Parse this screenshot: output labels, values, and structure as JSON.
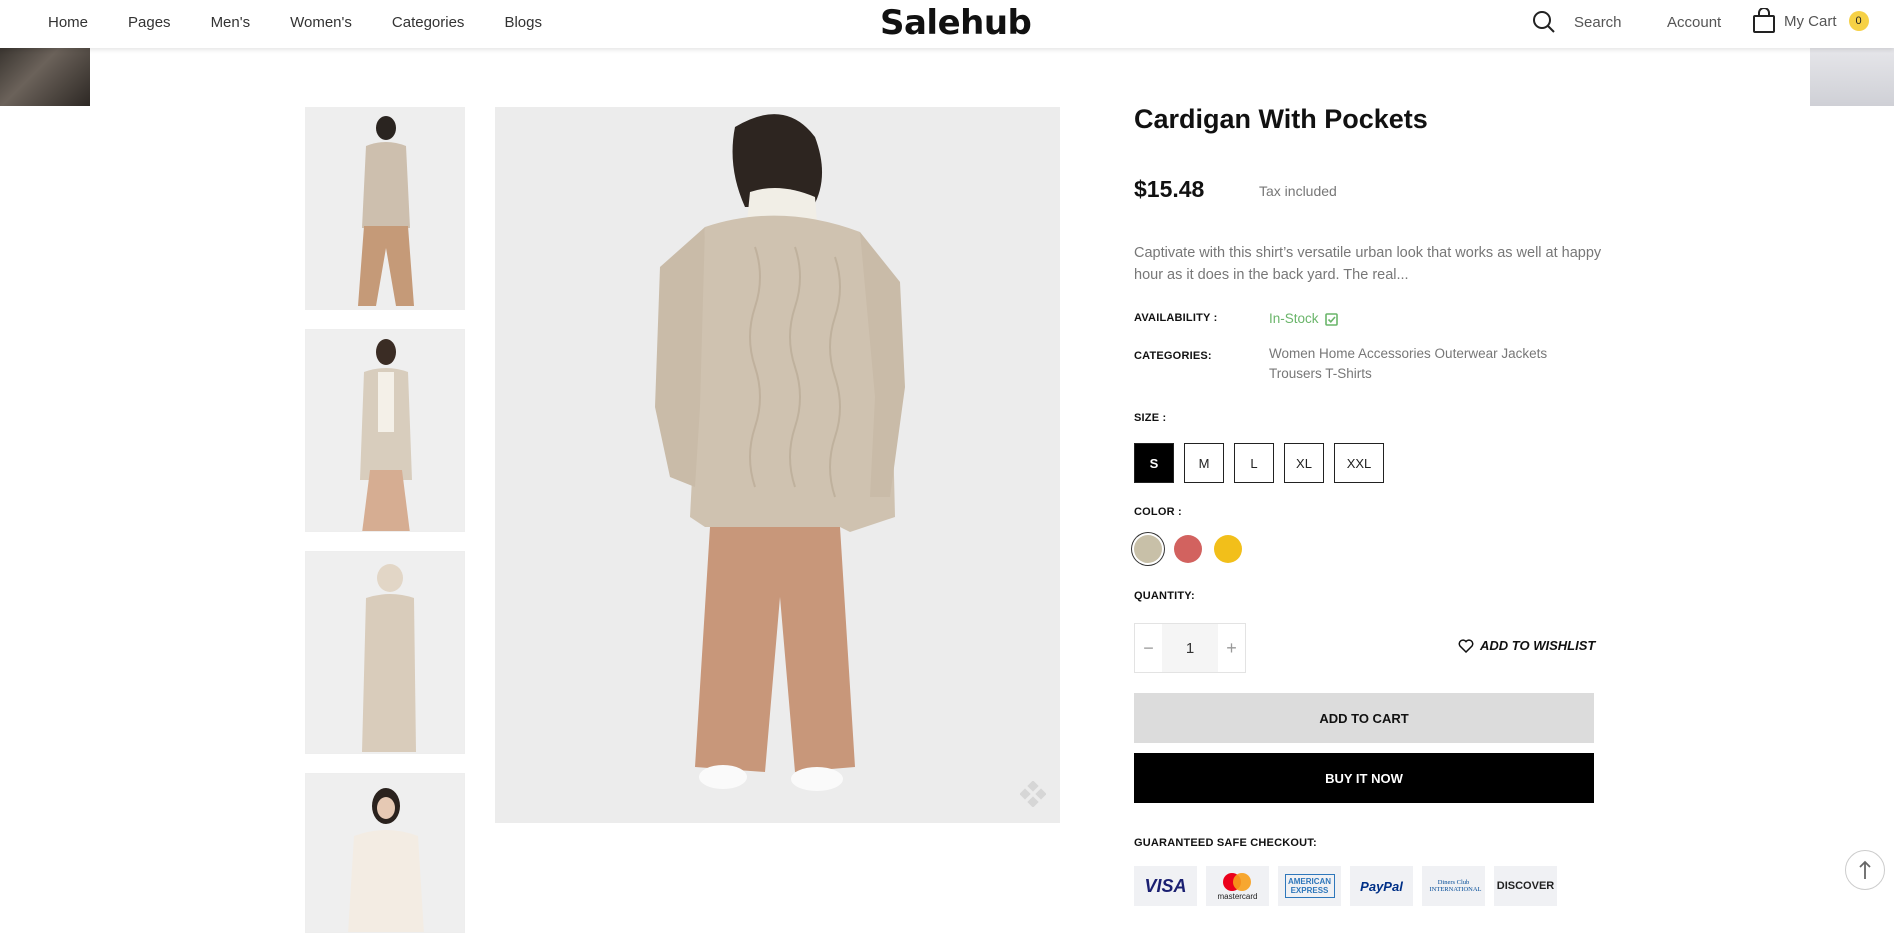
{
  "nav": {
    "items": [
      "Home",
      "Pages",
      "Men's",
      "Women's",
      "Categories",
      "Blogs"
    ],
    "logo": "Salehub",
    "search_label": "Search",
    "account_label": "Account",
    "cart_label": "My Cart",
    "cart_count": "0"
  },
  "product": {
    "title": "Cardigan With Pockets",
    "price": "$15.48",
    "tax_note": "Tax included",
    "description": "Captivate with this shirt’s versatile urban look that works as well at happy hour as it does in the back yard. The real...",
    "availability_label": "AVAILABILITY :",
    "availability_value": "In-Stock",
    "categories_label": "CATEGORIES:",
    "categories_value": "Women Home Accessories Outerwear Jackets Trousers T-Shirts",
    "size_label": "SIZE :",
    "sizes": [
      "S",
      "M",
      "L",
      "XL",
      "XXL"
    ],
    "selected_size": "S",
    "color_label": "COLOR :",
    "colors": [
      "#c8c0a8",
      "#d2625f",
      "#f2bf1a"
    ],
    "selected_color_index": 0,
    "quantity_label": "QUANTITY:",
    "quantity": "1",
    "wishlist_label": "ADD TO WISHLIST",
    "add_to_cart_label": "ADD TO CART",
    "buy_now_label": "BUY IT NOW",
    "checkout_label": "GUARANTEED SAFE CHECKOUT:",
    "payment_methods": [
      "VISA",
      "mastercard",
      "AMERICAN EXPRESS",
      "PayPal",
      "Diners Club INTERNATIONAL",
      "DISCOVER"
    ]
  },
  "icons": {
    "search": "search-icon",
    "cart": "shopping-bag-icon",
    "wishlist": "heart-icon",
    "zoom": "zoom-icon",
    "back_to_top": "arrow-up-icon"
  },
  "colors": {
    "accent": "#f6d146",
    "in_stock": "#6ab56a",
    "primary_button": "#000000",
    "secondary_button": "#dcdcdc"
  }
}
